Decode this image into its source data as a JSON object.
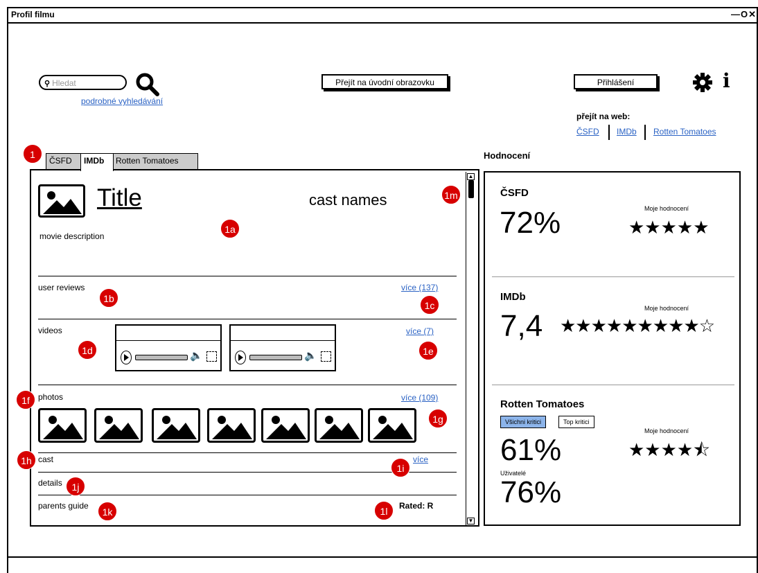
{
  "window": {
    "title": "Profil filmu",
    "controls": "—O✕"
  },
  "header": {
    "search_placeholder": "Hledat",
    "advanced_search": "podrobné vyhledávání",
    "home_button": "Přejít na úvodní obrazovku",
    "login_button": "Přihlášení",
    "info_icon": "i",
    "goto_web_label": "přejít na web:",
    "web_links": [
      "ČSFD",
      "IMDb",
      "Rotten Tomatoes"
    ]
  },
  "tabs": [
    "ČSFD",
    "IMDb",
    "Rotten Tomatoes"
  ],
  "active_tab": "IMDb",
  "badges": {
    "tabs": "1",
    "a": "1a",
    "b": "1b",
    "c": "1c",
    "d": "1d",
    "e": "1e",
    "f": "1f",
    "g": "1g",
    "h": "1h",
    "i": "1i",
    "j": "1j",
    "k": "1k",
    "l": "1l",
    "m": "1m"
  },
  "movie": {
    "title": "Title",
    "cast_names": "cast names",
    "description": "movie description",
    "user_reviews_label": "user reviews",
    "user_reviews_more": "více (137)",
    "videos_label": "videos",
    "videos_more": "více (7)",
    "photos_label": "photos",
    "photos_more": "více (109)",
    "cast_label": "cast",
    "cast_more": "více",
    "details_label": "details",
    "parents_guide_label": "parents guide",
    "rating": "Rated: R"
  },
  "ratings": {
    "section_title": "Hodnocení",
    "my_rating_label": "Moje hodnocení",
    "csfd": {
      "name": "ČSFD",
      "score": "72%",
      "stars": "★★★★★",
      "stars_value": 5,
      "stars_max": 5
    },
    "imdb": {
      "name": "IMDb",
      "score": "7,4",
      "stars": "★★★★★★★★★☆",
      "stars_value": 9,
      "stars_max": 10
    },
    "rt": {
      "name": "Rotten Tomatoes",
      "toggle": [
        "Všichni kritici",
        "Top kritici"
      ],
      "critics_score": "61%",
      "users_label": "Uživatelé",
      "users_score": "76%",
      "stars": "★★★★⯪",
      "stars_value": 4.5,
      "stars_max": 5
    }
  },
  "colors": {
    "badge": "#d70000",
    "link": "#2a62c4",
    "tab_inactive": "#cccccc",
    "toggle_active": "#8cb4ea"
  }
}
